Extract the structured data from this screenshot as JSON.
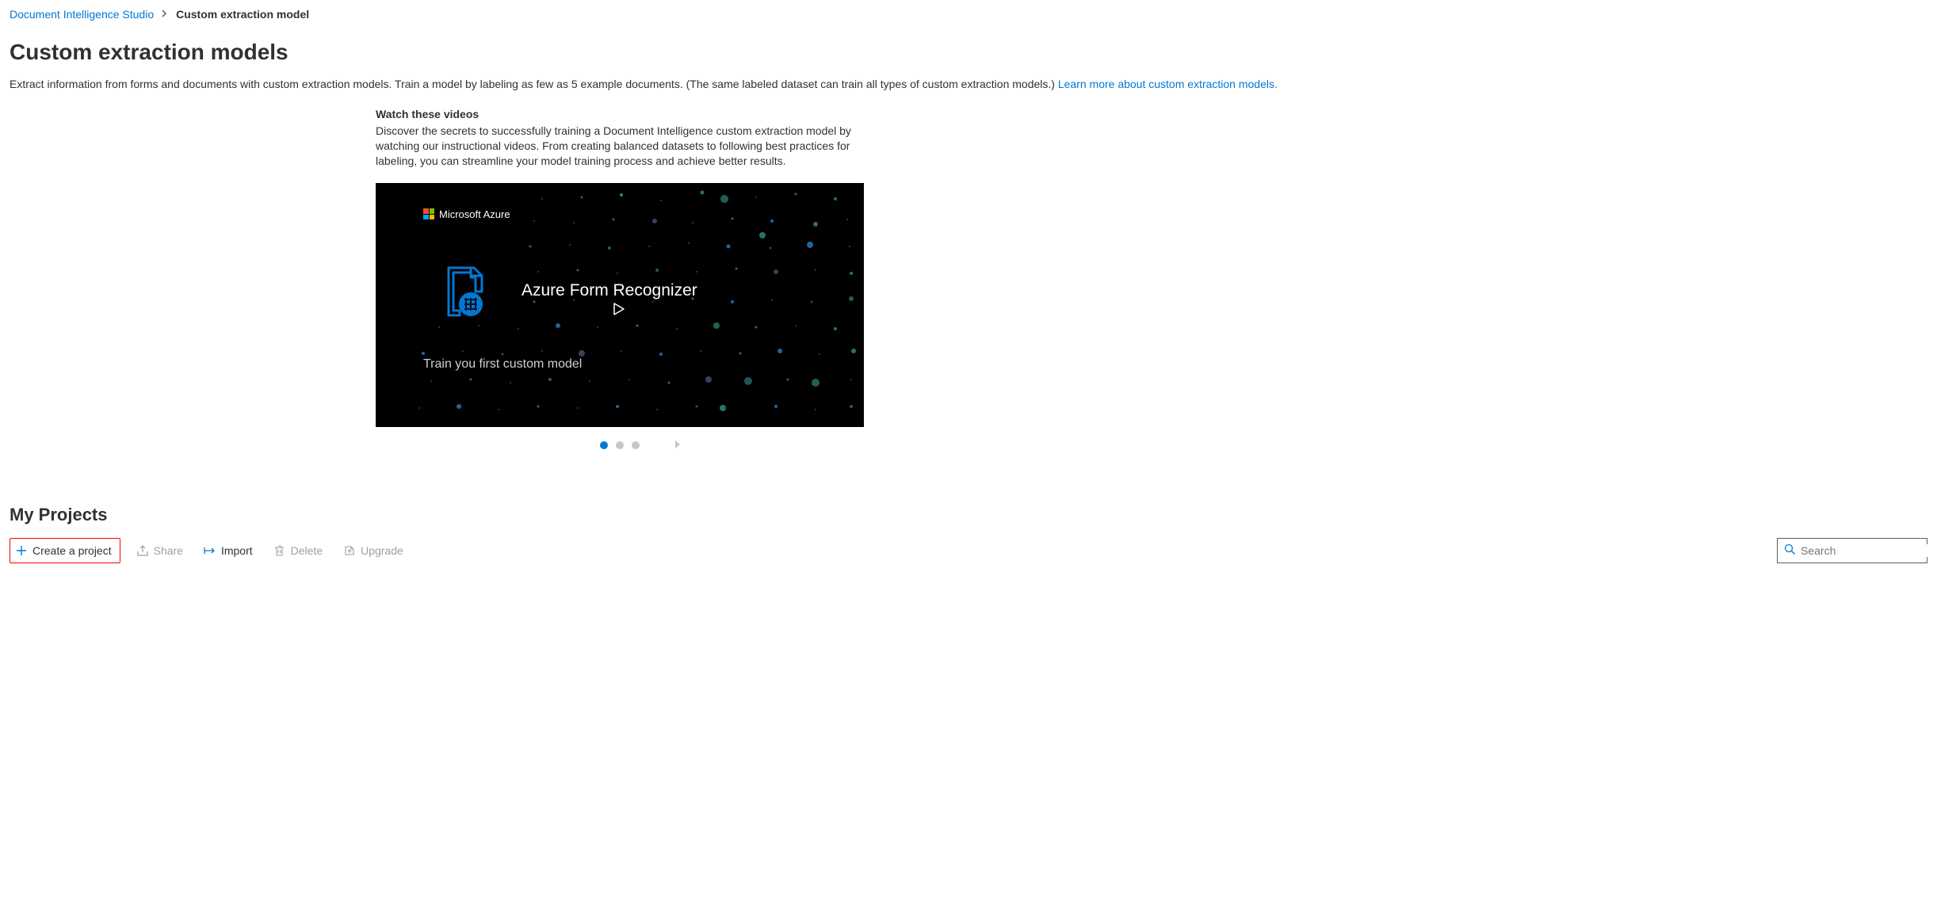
{
  "breadcrumb": {
    "root": "Document Intelligence Studio",
    "current": "Custom extraction model"
  },
  "page": {
    "title": "Custom extraction models",
    "intro": "Extract information from forms and documents with custom extraction models. Train a model by labeling as few as 5 example documents. (The same labeled dataset can train all types of custom extraction models.) ",
    "intro_link": "Learn more about custom extraction models."
  },
  "video": {
    "heading": "Watch these videos",
    "description": "Discover the secrets to successfully training a Document Intelligence custom extraction model by watching our instructional videos. From creating balanced datasets to following best practices for labeling, you can streamline your model training process and achieve better results.",
    "brand": "Microsoft Azure",
    "title_text": "Azure Form Recognizer",
    "subtitle_text": "Train you first custom model"
  },
  "projects": {
    "title": "My Projects"
  },
  "toolbar": {
    "create": "Create a project",
    "share": "Share",
    "import": "Import",
    "delete": "Delete",
    "upgrade": "Upgrade"
  },
  "search": {
    "placeholder": "Search"
  }
}
